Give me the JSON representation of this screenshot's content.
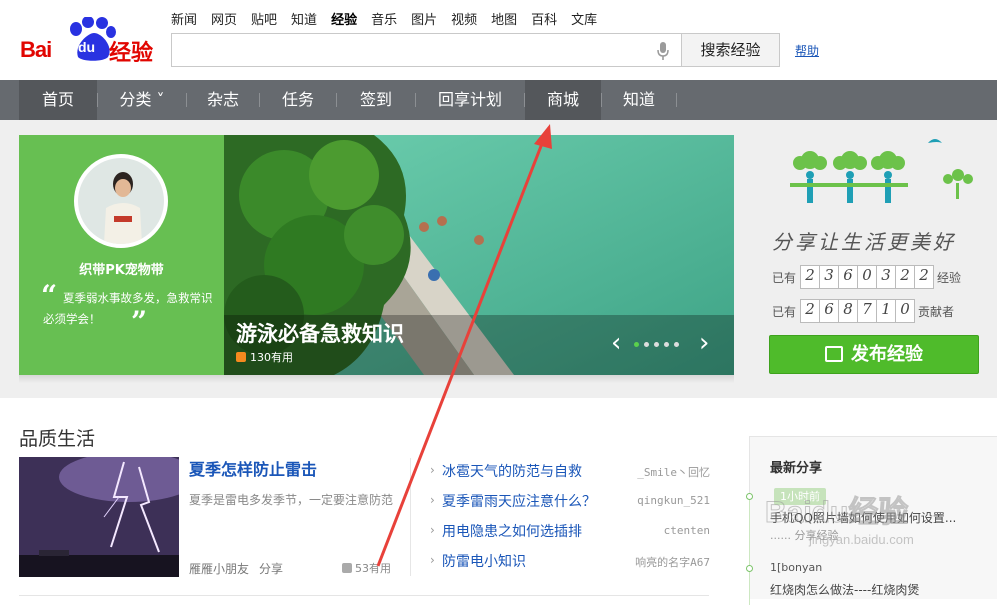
{
  "brand": {
    "logo_text": "Bai",
    "logo_du": "du",
    "logo_suffix": "经验"
  },
  "topnav": [
    {
      "label": "新闻",
      "active": false
    },
    {
      "label": "网页",
      "active": false
    },
    {
      "label": "贴吧",
      "active": false
    },
    {
      "label": "知道",
      "active": false
    },
    {
      "label": "经验",
      "active": true
    },
    {
      "label": "音乐",
      "active": false
    },
    {
      "label": "图片",
      "active": false
    },
    {
      "label": "视频",
      "active": false
    },
    {
      "label": "地图",
      "active": false
    },
    {
      "label": "百科",
      "active": false
    },
    {
      "label": "文库",
      "active": false
    }
  ],
  "search": {
    "value": "",
    "button_label": "搜索经验",
    "help_label": "帮助"
  },
  "mainnav": [
    {
      "label": "首页",
      "selected": true
    },
    {
      "label": "分类 ˅",
      "selected": false
    },
    {
      "label": "杂志",
      "selected": false
    },
    {
      "label": "任务",
      "selected": false
    },
    {
      "label": "签到",
      "selected": false
    },
    {
      "label": "回享计划",
      "selected": false
    },
    {
      "label": "商城",
      "selected": true
    },
    {
      "label": "知道",
      "selected": false
    }
  ],
  "profile": {
    "username": "织带PK宠物带",
    "quote": "夏季弱水事故多发，急救常识必须学会！"
  },
  "slide": {
    "title": "游泳必备急救知识",
    "likes": "130有用",
    "active_dot": 0,
    "dot_count": 5
  },
  "side": {
    "slogan": "分享让生活更美好",
    "stats": [
      {
        "prefix": "已有",
        "digits": [
          "2",
          "3",
          "6",
          "0",
          "3",
          "2",
          "2"
        ],
        "suffix": "经验"
      },
      {
        "prefix": "已有",
        "digits": [
          "2",
          "6",
          "8",
          "7",
          "1",
          "0"
        ],
        "suffix": "贡献者"
      }
    ],
    "publish_label": "发布经验"
  },
  "quality": {
    "section_title": "品质生活",
    "feature": {
      "title": "夏季怎样防止雷击",
      "desc": "夏季是雷电多发季节，一定要注意防范",
      "author": "雁雁小朋友",
      "share": "分享",
      "likes": "53有用"
    },
    "list": [
      {
        "title": "冰雹天气的防范与自救",
        "author": "_Smile丶回忆"
      },
      {
        "title": "夏季雷雨天应注意什么？",
        "author": "qingkun_521"
      },
      {
        "title": "用电隐患之如何选插排",
        "author": "ctenten"
      },
      {
        "title": "防雷电小知识",
        "author": "响亮的名字A67"
      }
    ]
  },
  "recent": {
    "title": "最新分享",
    "time_badge": "1小时前",
    "item1": "手机QQ照片墙如何使用如何设置...",
    "item1_sub": "...... 分享经验",
    "item2_prefix": "1[bonyan",
    "item2": "红烧肉怎么做法----红烧肉煲"
  },
  "watermark": {
    "text": "Baidu经验",
    "url": "jingyan.baidu.com"
  },
  "colors": {
    "brand_red": "#e10601",
    "nav_bg": "#666a6f",
    "green": "#67bf52",
    "publish_green": "#4fbb2b",
    "link_blue": "#1a56b8",
    "annotation_red": "#e8413a"
  }
}
